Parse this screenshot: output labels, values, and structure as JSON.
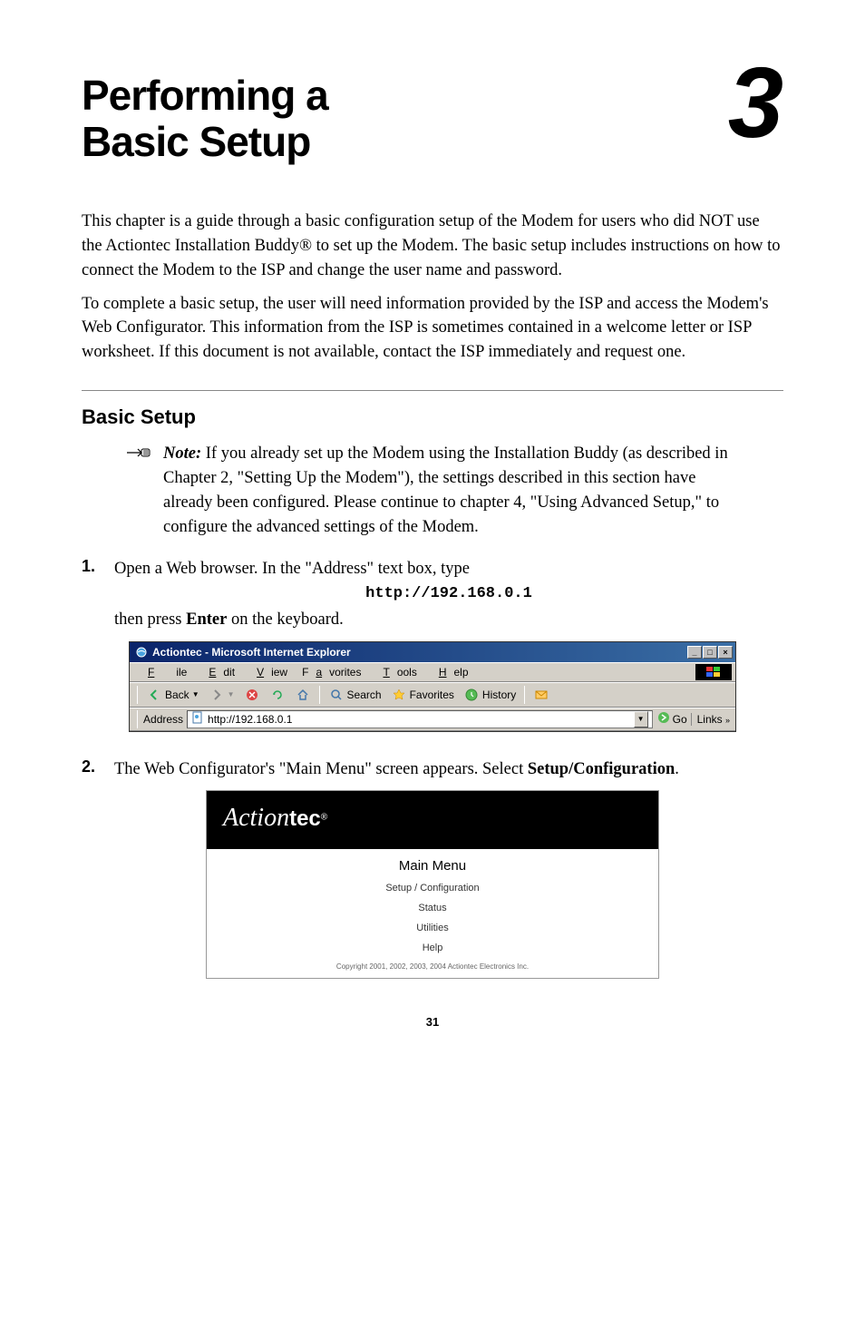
{
  "chapter": {
    "title_line1": "Performing a",
    "title_line2": "Basic Setup",
    "number": "3"
  },
  "intro": {
    "p1": "This chapter is a guide through a basic configuration setup of the Modem for users who did NOT use the Actiontec Installation Buddy® to set up the Modem. The basic setup includes instructions on how to connect the Modem to the ISP and change the user name and password.",
    "p2": "To complete a basic setup, the user will need information provided by the ISP and access the Modem's Web Configurator. This information from the ISP is sometimes contained in a welcome letter or ISP worksheet. If this document is not available, contact the ISP immediately and request one."
  },
  "section": {
    "heading": "Basic Setup",
    "note_label": "Note:",
    "note_text": " If you already set up the Modem using the Installation Buddy (as described in Chapter 2,  \"Setting Up the Modem\"), the settings described in this section have already been configured. Please continue to chapter 4, \"Using Advanced Setup,\" to configure the advanced settings of the Modem."
  },
  "step1": {
    "num": "1.",
    "text_a": "Open a Web browser. In the \"Address\" text box, type",
    "address": "http://192.168.0.1",
    "text_b_prefix": "then press ",
    "text_b_bold": "Enter",
    "text_b_suffix": " on the keyboard."
  },
  "ie": {
    "title": "Actiontec - Microsoft Internet Explorer",
    "menu": {
      "file": "File",
      "edit": "Edit",
      "view": "View",
      "favorites": "Favorites",
      "tools": "Tools",
      "help": "Help"
    },
    "toolbar": {
      "back": "Back",
      "search": "Search",
      "favorites": "Favorites",
      "history": "History"
    },
    "address_label": "Address",
    "address_value": "http://192.168.0.1",
    "go": "Go",
    "links": "Links"
  },
  "step2": {
    "num": "2.",
    "text_prefix": "The Web Configurator's \"Main Menu\" screen appears. Select ",
    "text_bold": "Setup/Configuration",
    "text_suffix": "."
  },
  "actiontec": {
    "logo_script": "Action",
    "logo_tec": "tec",
    "main_menu": "Main Menu",
    "items": {
      "setup": "Setup / Configuration",
      "status": "Status",
      "utilities": "Utilities",
      "help": "Help"
    },
    "copyright": "Copyright 2001, 2002, 2003, 2004 Actiontec Electronics Inc."
  },
  "page_number": "31"
}
